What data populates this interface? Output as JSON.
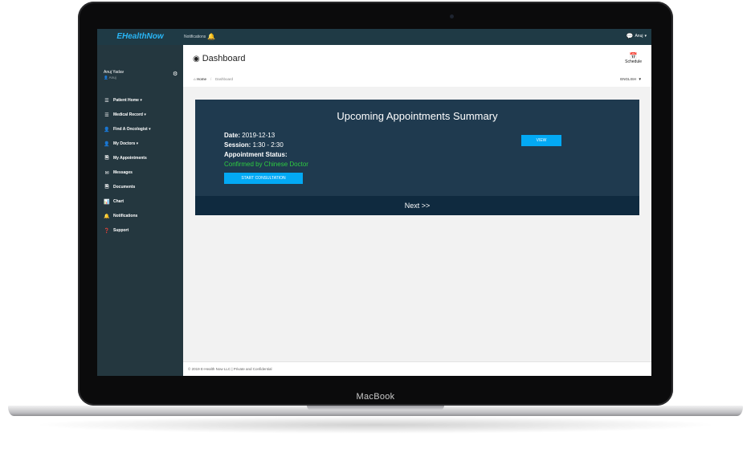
{
  "device": {
    "label": "MacBook"
  },
  "app": {
    "logo": "EHealthNow",
    "notifications_label": "Notifications",
    "user_short": "Anuj"
  },
  "sidebar": {
    "profile_name": "Anuj Yadav",
    "profile_username": "Anuj",
    "items": [
      {
        "label": "Patient Home",
        "icon": "list-icon",
        "has_dropdown": true
      },
      {
        "label": "Medical Record",
        "icon": "list-icon",
        "has_dropdown": true
      },
      {
        "label": "Find A Oncologist",
        "icon": "user-icon",
        "has_dropdown": true
      },
      {
        "label": "My Doctors",
        "icon": "user-icon",
        "has_dropdown": true
      },
      {
        "label": "My Appointments",
        "icon": "document-icon",
        "has_dropdown": false
      },
      {
        "label": "Messages",
        "icon": "envelope-icon",
        "has_dropdown": false
      },
      {
        "label": "Documents",
        "icon": "document-icon",
        "has_dropdown": false
      },
      {
        "label": "Chart",
        "icon": "chart-icon",
        "has_dropdown": false
      },
      {
        "label": "Notifications",
        "icon": "bell-icon",
        "has_dropdown": false
      },
      {
        "label": "Support",
        "icon": "help-icon",
        "has_dropdown": false
      }
    ]
  },
  "header": {
    "title": "Dashboard",
    "schedule_label": "Schedule"
  },
  "breadcrumb": {
    "home": "Home",
    "separator": "/",
    "current": "Dashboard",
    "language": "ENGLISH"
  },
  "appointment_card": {
    "title": "Upcoming Appointments Summary",
    "date_label": "Date:",
    "date_value": "2019-12-13",
    "session_label": "Session:",
    "session_value": "1:30 - 2:30",
    "status_label": "Appointment Status:",
    "status_value": "Confirmed by Chinese Doctor",
    "view_button": "VIEW",
    "start_button": "START CONSULTATION",
    "next_label": "Next >>"
  },
  "footer": {
    "text": "© 2019 E-Health Now LLC | Private and Confidential"
  },
  "colors": {
    "topbar": "#1f3a45",
    "sidebar": "#24373f",
    "card": "#1f3a4f",
    "next_bar": "#0f2a3f",
    "accent": "#03a9f4",
    "status_green": "#2ecc40",
    "logo": "#29b6f6"
  }
}
